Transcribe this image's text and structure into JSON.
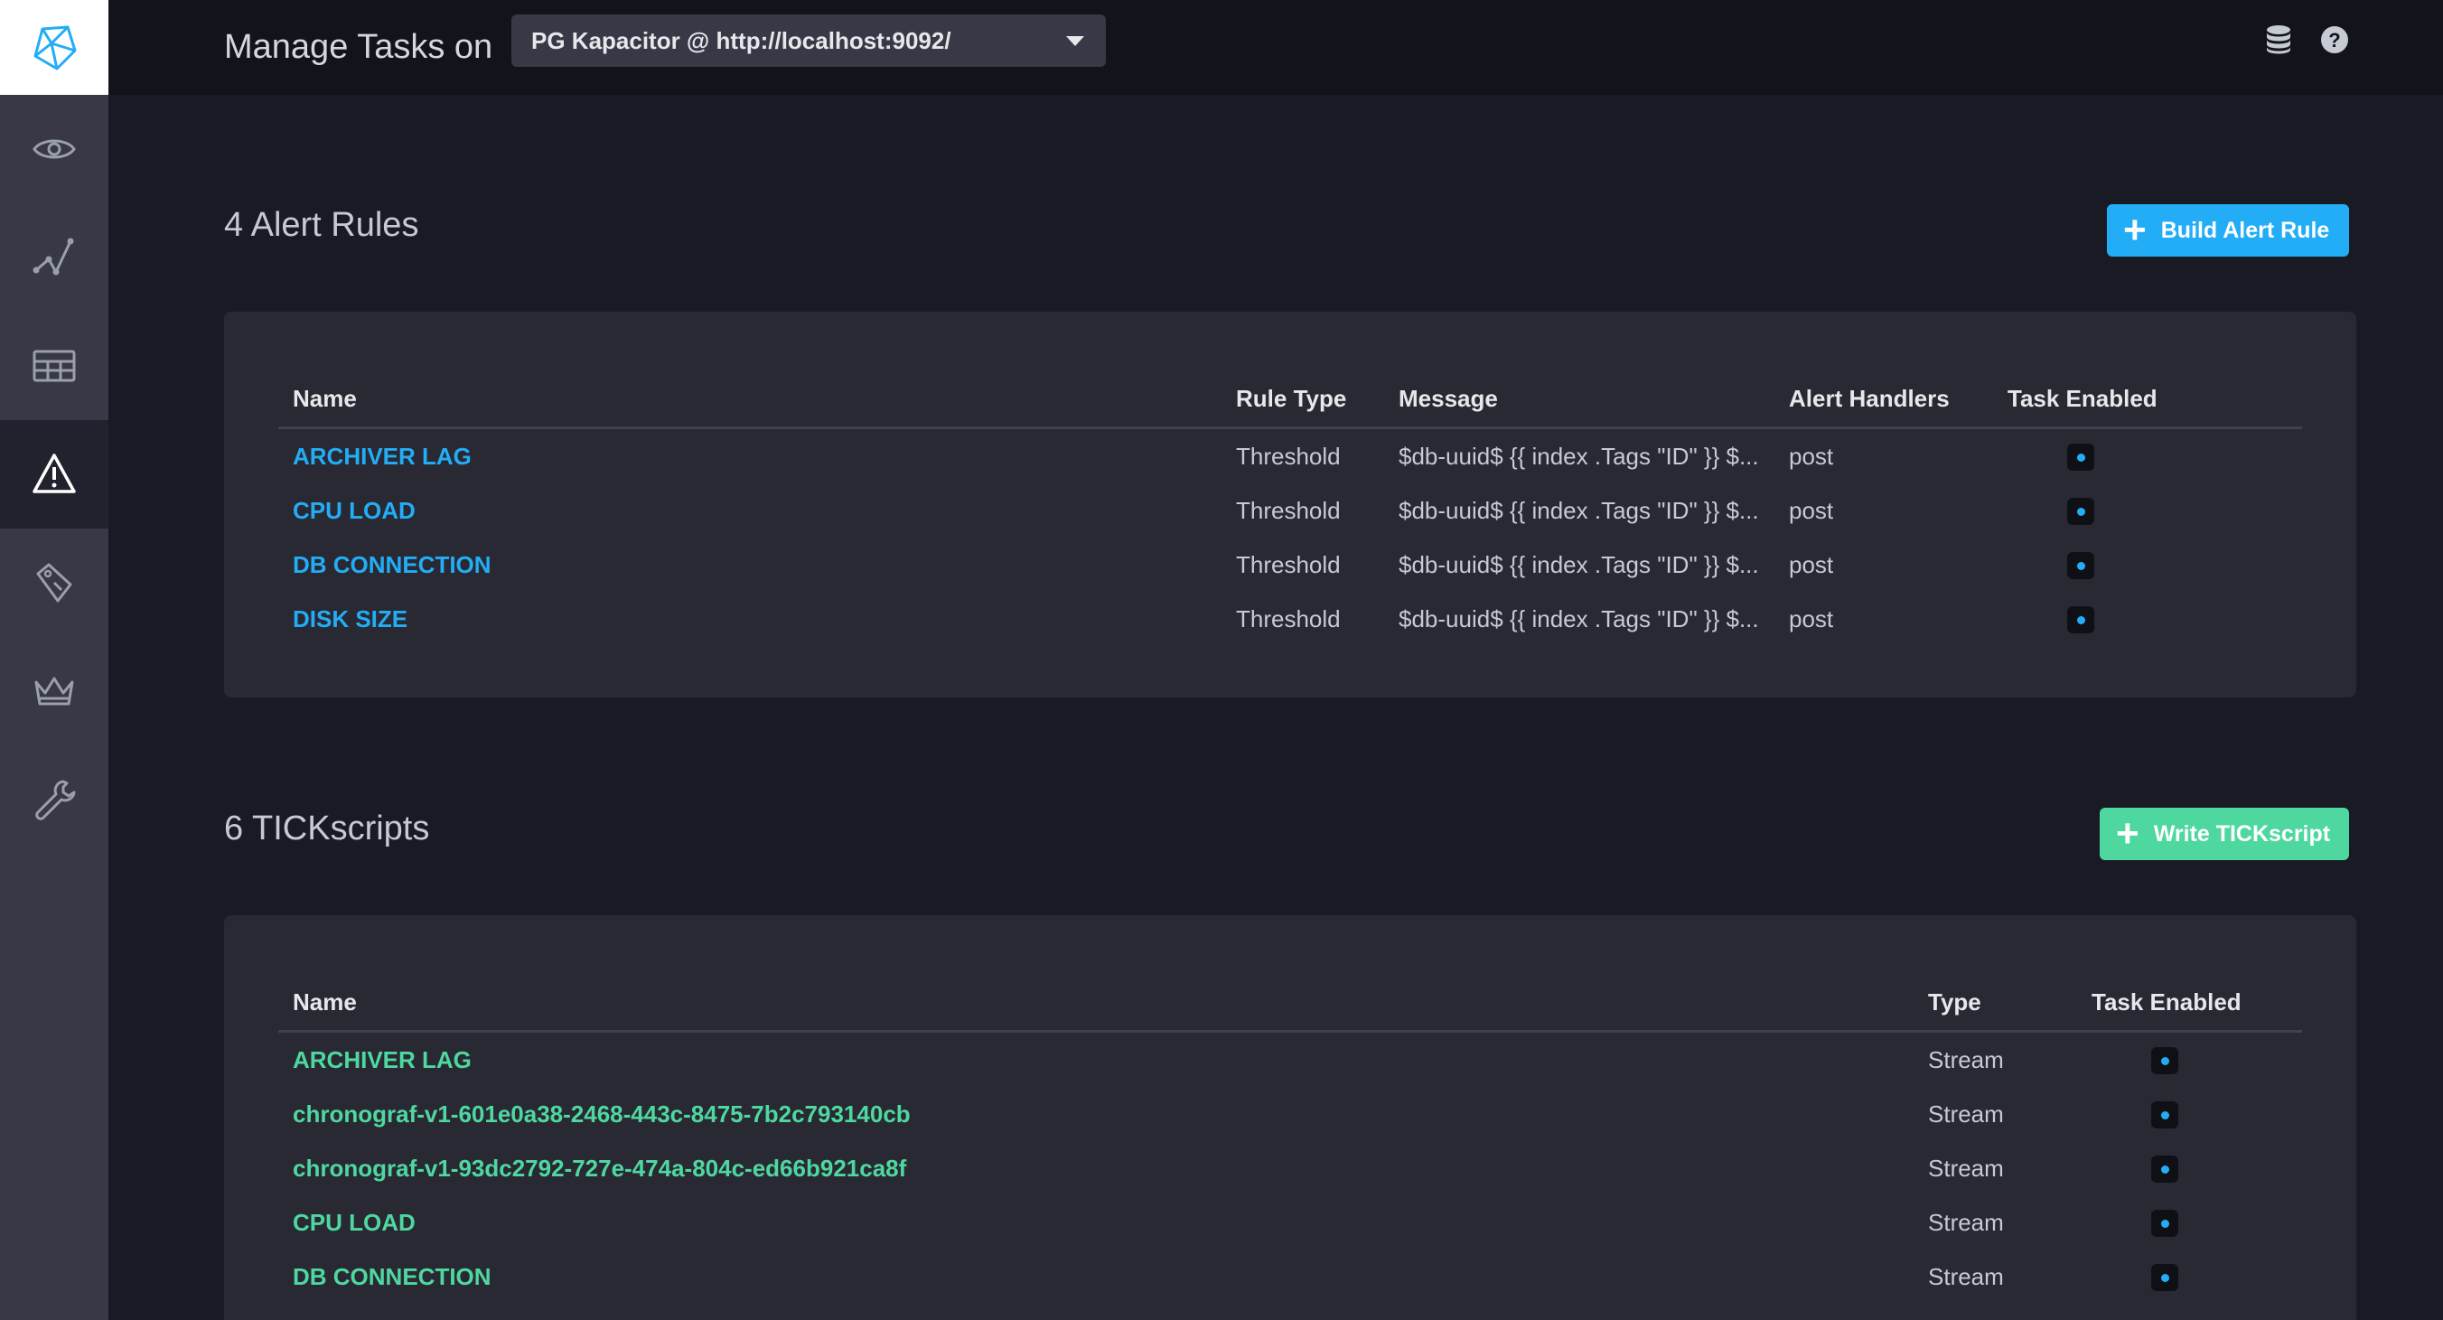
{
  "header": {
    "title": "Manage Tasks on",
    "source": "PG Kapacitor @ http://localhost:9092/"
  },
  "sidebar": {
    "items": [
      {
        "icon": "eye-icon"
      },
      {
        "icon": "graph-icon"
      },
      {
        "icon": "dashboards-grid-icon"
      },
      {
        "icon": "alert-triangle-icon",
        "active": true
      },
      {
        "icon": "tag-icon"
      },
      {
        "icon": "crown-icon"
      },
      {
        "icon": "wrench-icon"
      }
    ]
  },
  "alert_rules": {
    "title": "4 Alert Rules",
    "button_label": "Build Alert Rule",
    "columns": {
      "name": "Name",
      "rule_type": "Rule Type",
      "message": "Message",
      "handlers": "Alert Handlers",
      "enabled": "Task Enabled"
    },
    "rows": [
      {
        "name": "ARCHIVER LAG",
        "rule_type": "Threshold",
        "message": "$db-uuid$ {{ index .Tags \"ID\" }} $...",
        "handlers": "post",
        "enabled": true
      },
      {
        "name": "CPU LOAD",
        "rule_type": "Threshold",
        "message": "$db-uuid$ {{ index .Tags \"ID\" }} $...",
        "handlers": "post",
        "enabled": true
      },
      {
        "name": "DB CONNECTION",
        "rule_type": "Threshold",
        "message": "$db-uuid$ {{ index .Tags \"ID\" }} $...",
        "handlers": "post",
        "enabled": true
      },
      {
        "name": "DISK SIZE",
        "rule_type": "Threshold",
        "message": "$db-uuid$ {{ index .Tags \"ID\" }} $...",
        "handlers": "post",
        "enabled": true
      }
    ]
  },
  "tickscripts": {
    "title": "6 TICKscripts",
    "button_label": "Write TICKscript",
    "columns": {
      "name": "Name",
      "type": "Type",
      "enabled": "Task Enabled"
    },
    "rows": [
      {
        "name": "ARCHIVER LAG",
        "type": "Stream",
        "enabled": true
      },
      {
        "name": "chronograf-v1-601e0a38-2468-443c-8475-7b2c793140cb",
        "type": "Stream",
        "enabled": true
      },
      {
        "name": "chronograf-v1-93dc2792-727e-474a-804c-ed66b921ca8f",
        "type": "Stream",
        "enabled": true
      },
      {
        "name": "CPU LOAD",
        "type": "Stream",
        "enabled": true
      },
      {
        "name": "DB CONNECTION",
        "type": "Stream",
        "enabled": true
      }
    ]
  },
  "colors": {
    "accent_blue": "#22adf6",
    "accent_green": "#4ed8a0"
  }
}
